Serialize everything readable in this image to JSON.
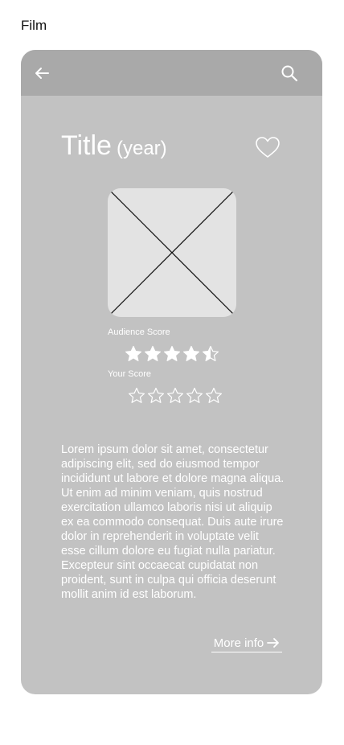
{
  "frame": {
    "label": "Film"
  },
  "appbar": {
    "back_icon": "arrow-left-icon",
    "search_icon": "search-icon"
  },
  "movie": {
    "title": "Title",
    "year": "(year)",
    "favorite_icon": "heart-outline-icon",
    "poster_icon": "image-placeholder-icon",
    "audience_score": {
      "label": "Audience Score",
      "rating": 4.5,
      "max": 5
    },
    "your_score": {
      "label": "Your Score",
      "rating": 0,
      "max": 5
    },
    "description": "Lorem ipsum dolor sit amet, consectetur adipiscing elit, sed do eiusmod tempor incididunt ut labore et dolore magna aliqua. Ut enim ad minim veniam, quis nostrud exercitation ullamco laboris nisi ut aliquip ex ea commodo consequat. Duis aute irure dolor in reprehenderit in voluptate velit esse cillum dolore eu fugiat nulla pariatur. Excepteur sint occaecat cupidatat non proident, sunt in culpa qui officia deserunt mollit anim id est laborum."
  },
  "actions": {
    "more_info_label": "More info",
    "more_info_icon": "arrow-right-icon"
  },
  "colors": {
    "card": "#c2c2c2",
    "appbar": "#a9a9a9",
    "poster": "#e3e3e3",
    "text": "#ffffff"
  }
}
